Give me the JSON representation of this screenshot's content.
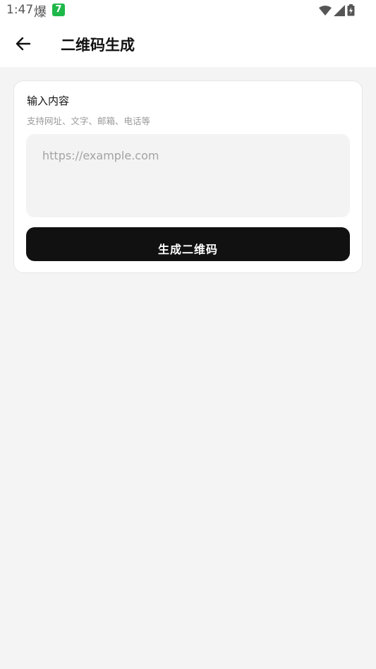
{
  "status_bar": {
    "time": "1:47",
    "notification_char": "爆",
    "app_icon_char": "7"
  },
  "header": {
    "title": "二维码生成"
  },
  "form": {
    "title": "输入内容",
    "subtitle": "支持网址、文字、邮箱、电话等",
    "input_placeholder": "https://example.com",
    "input_value": "",
    "generate_label": "生成二维码"
  },
  "colors": {
    "background": "#f4f4f4",
    "card": "#ffffff",
    "button": "#111111",
    "input_bg": "#f3f3f3"
  }
}
